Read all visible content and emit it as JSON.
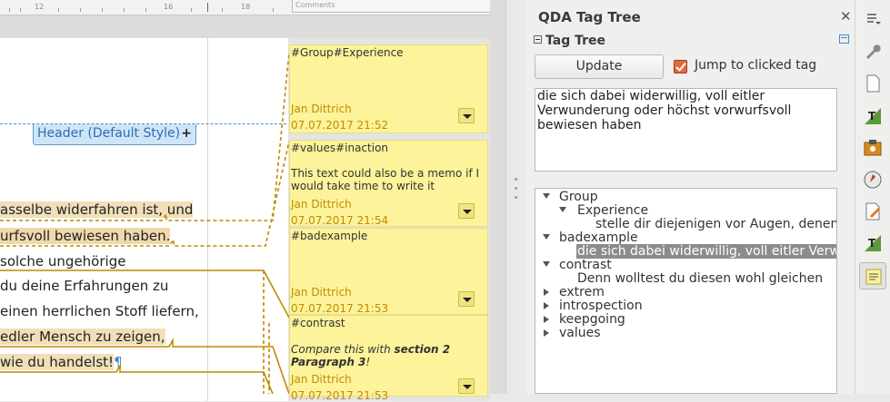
{
  "ruler": {
    "marks": [
      "12",
      "16",
      "18"
    ],
    "comments_label": "Comments"
  },
  "document": {
    "header_label": "Header (Default Style)",
    "header_plus": "+",
    "lines": [
      "asselbe widerfahren ist, und",
      "urfsvoll bewiesen haben.",
      "solche ungehörige",
      " du deine Erfahrungen zu",
      "einen herrlichen Stoff liefern,",
      " edler Mensch zu zeigen,",
      "wie du handelst!"
    ],
    "pilcrow": "¶"
  },
  "comments": [
    {
      "tag": "#Group#Experience",
      "body": "",
      "author": "Jan Dittrich",
      "date": "07.07.2017 21:52"
    },
    {
      "tag": "#values#inaction",
      "body": "This text could also be a memo if I would take time to write it",
      "author": "Jan Dittrich",
      "date": "07.07.2017 21:54"
    },
    {
      "tag": "#badexample",
      "body": "",
      "author": "Jan Dittrich",
      "date": "07.07.2017 21:53"
    },
    {
      "tag": "#contrast",
      "body_prefix": "Compare this with ",
      "body_bold": "section 2 Paragraph 3",
      "body_suffix": "!",
      "author": "Jan Dittrich",
      "date": "07.07.2017 21:53"
    }
  ],
  "qda": {
    "title": "QDA Tag Tree",
    "close": "✕",
    "section": "Tag Tree",
    "update_label": "Update",
    "jump_label": "Jump to clicked tag",
    "jump_checked": true,
    "selected_text": "die sich dabei widerwillig, voll eitler Verwunderung oder höchst vorwurfsvoll bewiesen haben",
    "tree": [
      {
        "label": "Group",
        "expanded": true,
        "level": 0
      },
      {
        "label": "Experience",
        "expanded": true,
        "level": 1
      },
      {
        "label": "stelle dir diejenigen vor Augen, denen",
        "level": 2
      },
      {
        "label": "badexample",
        "expanded": true,
        "level": 0
      },
      {
        "label": "die sich dabei widerwillig, voll eitler Verw",
        "level": 2,
        "selected": true
      },
      {
        "label": "contrast",
        "expanded": true,
        "level": 0
      },
      {
        "label": "Denn wolltest du diesen wohl gleichen",
        "level": 2
      },
      {
        "label": "extrem",
        "expanded": false,
        "level": 0
      },
      {
        "label": "introspection",
        "expanded": false,
        "level": 0
      },
      {
        "label": "keepgoing",
        "expanded": false,
        "level": 0
      },
      {
        "label": "values",
        "expanded": false,
        "level": 0
      }
    ]
  },
  "colors": {
    "note_bg": "#fcf39a",
    "note_meta": "#c48a00",
    "header_blue": "#2d6fb2",
    "highlight": "#f0dfb8",
    "connector": "#c08a00"
  },
  "icons": [
    "menu-icon",
    "wrench-icon",
    "page-icon",
    "styles-icon",
    "gallery-icon",
    "navigator-icon",
    "page-edit-icon",
    "styles-icon-2",
    "qda-note-icon"
  ]
}
